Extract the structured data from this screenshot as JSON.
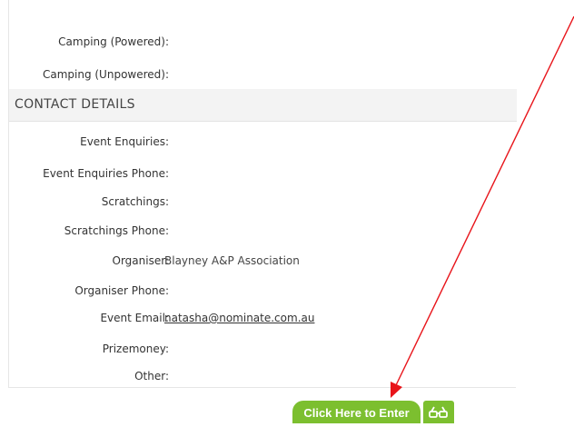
{
  "top_rows": [
    {
      "label": "Camping (Powered):",
      "value": ""
    },
    {
      "label": "Camping (Unpowered):",
      "value": ""
    }
  ],
  "contact_section": {
    "title": "CONTACT DETAILS",
    "rows": [
      {
        "label": "Event Enquiries:",
        "value": ""
      },
      {
        "label": "Event Enquiries Phone:",
        "value": ""
      },
      {
        "label": "Scratchings:",
        "value": ""
      },
      {
        "label": "Scratchings Phone:",
        "value": ""
      },
      {
        "label": "Organiser:",
        "value": "Blayney A&P Association"
      },
      {
        "label": "Organiser Phone:",
        "value": ""
      },
      {
        "label": "Event Email:",
        "value": "natasha@nominate.com.au"
      },
      {
        "label": "Prizemoney:",
        "value": ""
      },
      {
        "label": "Other:",
        "value": ""
      }
    ]
  },
  "actions": {
    "enter_label": "Click Here to Enter",
    "glasses_icon": "glasses-icon"
  },
  "colors": {
    "button_green": "#7cbf2f",
    "arrow_red": "#e8141a"
  }
}
